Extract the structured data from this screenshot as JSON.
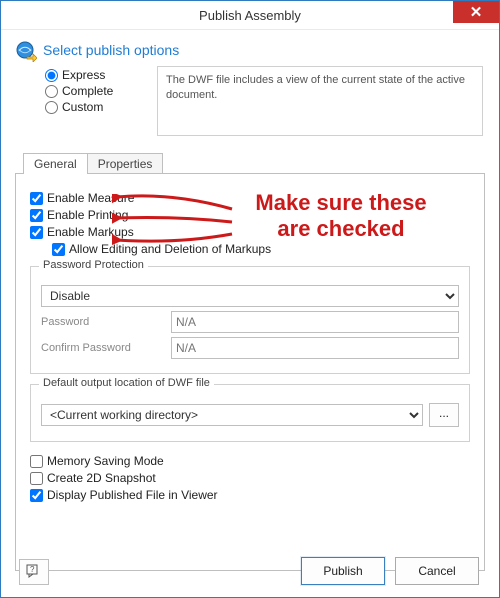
{
  "window": {
    "title": "Publish Assembly"
  },
  "header": {
    "title": "Select publish options",
    "description": "The DWF file includes a view of the current state of the active document."
  },
  "radios": {
    "express": "Express",
    "complete": "Complete",
    "custom": "Custom"
  },
  "tabs": {
    "general": "General",
    "properties": "Properties"
  },
  "general": {
    "enable_measure": "Enable Measure",
    "enable_printing": "Enable Printing",
    "enable_markups": "Enable Markups",
    "allow_markup_edit": "Allow Editing and Deletion of Markups",
    "password_protection_legend": "Password Protection",
    "password_select_value": "Disable",
    "password_label": "Password",
    "confirm_password_label": "Confirm Password",
    "na_placeholder": "N/A",
    "output_legend": "Default output location of DWF file",
    "output_value": "<Current working directory>",
    "browse_label": "...",
    "memory_saving": "Memory Saving Mode",
    "create_snapshot": "Create 2D Snapshot",
    "display_in_viewer": "Display Published File in Viewer"
  },
  "buttons": {
    "publish": "Publish",
    "cancel": "Cancel"
  },
  "callout": {
    "line1": "Make sure these",
    "line2": "are checked"
  }
}
